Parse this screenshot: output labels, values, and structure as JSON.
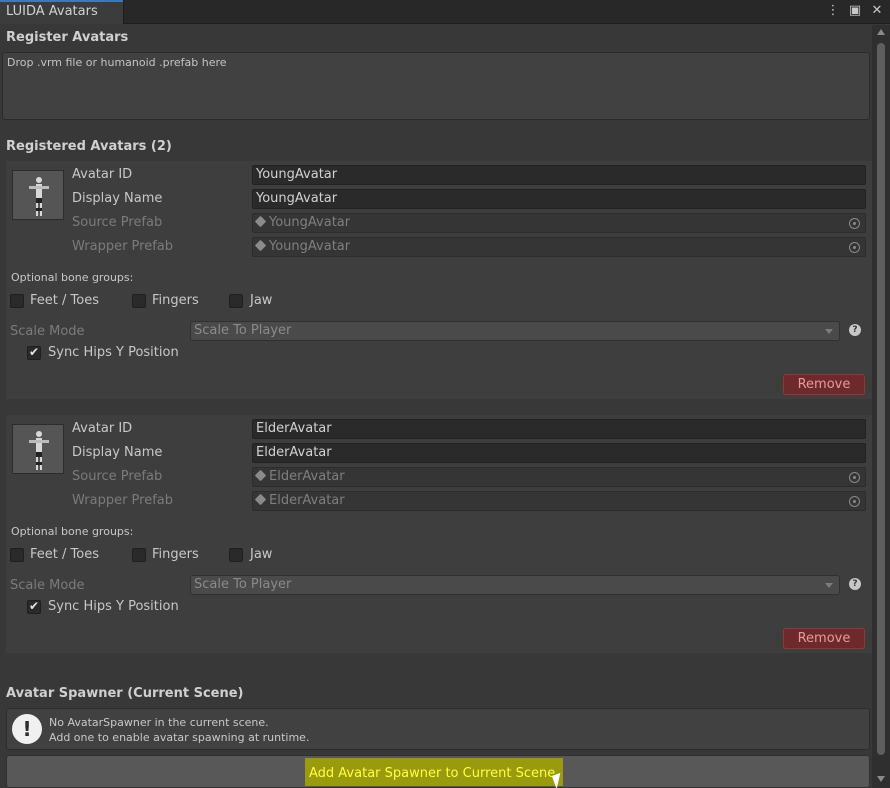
{
  "window": {
    "tab_title": "LUIDA Avatars",
    "icons": [
      "kebab-menu-icon",
      "maximize-icon",
      "close-icon"
    ]
  },
  "register": {
    "title": "Register Avatars",
    "dropzone_text": "Drop .vrm file or humanoid .prefab here"
  },
  "registered": {
    "title": "Registered Avatars (2)",
    "avatars": [
      {
        "avatar_id_label": "Avatar ID",
        "avatar_id": "YoungAvatar",
        "display_name_label": "Display Name",
        "display_name": "YoungAvatar",
        "source_prefab_label": "Source Prefab",
        "source_prefab": "YoungAvatar",
        "wrapper_prefab_label": "Wrapper Prefab",
        "wrapper_prefab": "YoungAvatar",
        "bone_groups_label": "Optional bone groups:",
        "feet_toes": "Feet / Toes",
        "fingers": "Fingers",
        "jaw": "Jaw",
        "scale_mode_label": "Scale Mode",
        "scale_mode": "Scale To Player",
        "sync_hips": "Sync Hips Y Position",
        "sync_hips_checked": true,
        "remove": "Remove"
      },
      {
        "avatar_id_label": "Avatar ID",
        "avatar_id": "ElderAvatar",
        "display_name_label": "Display Name",
        "display_name": "ElderAvatar",
        "source_prefab_label": "Source Prefab",
        "source_prefab": "ElderAvatar",
        "wrapper_prefab_label": "Wrapper Prefab",
        "wrapper_prefab": "ElderAvatar",
        "bone_groups_label": "Optional bone groups:",
        "feet_toes": "Feet / Toes",
        "fingers": "Fingers",
        "jaw": "Jaw",
        "scale_mode_label": "Scale Mode",
        "scale_mode": "Scale To Player",
        "sync_hips": "Sync Hips Y Position",
        "sync_hips_checked": true,
        "remove": "Remove"
      }
    ]
  },
  "spawner": {
    "title": "Avatar Spawner (Current Scene)",
    "help_line1": "No AvatarSpawner in the current scene.",
    "help_line2": "Add one to enable avatar spawning at runtime.",
    "add_button": "Add Avatar Spawner to Current Scene"
  },
  "colors": {
    "background": "#383838",
    "remove_button": "#6e2a2a",
    "highlight": "#9a9a0e"
  }
}
